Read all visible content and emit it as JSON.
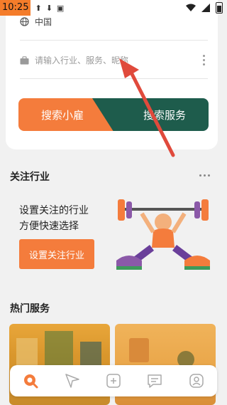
{
  "status_bar": {
    "time": "10:25"
  },
  "search": {
    "location": "中国",
    "keyword_placeholder": "请输入行业、服务、昵称",
    "btn_find_worker": "搜索小雇",
    "btn_find_service": "搜索服务"
  },
  "follow": {
    "title": "关注行业",
    "line1": "设置关注的行业",
    "line2": "方便快速选择",
    "button": "设置关注行业"
  },
  "hot": {
    "title": "热门服务"
  },
  "nav": {
    "items": [
      {
        "icon": "search-home-icon",
        "active": true
      },
      {
        "icon": "send-icon",
        "active": false
      },
      {
        "icon": "add-icon",
        "active": false
      },
      {
        "icon": "message-icon",
        "active": false
      },
      {
        "icon": "profile-icon",
        "active": false
      }
    ]
  },
  "colors": {
    "accent": "#f47c3c",
    "dark_green": "#1e5c4c",
    "arrow_red": "#e04a3c"
  }
}
